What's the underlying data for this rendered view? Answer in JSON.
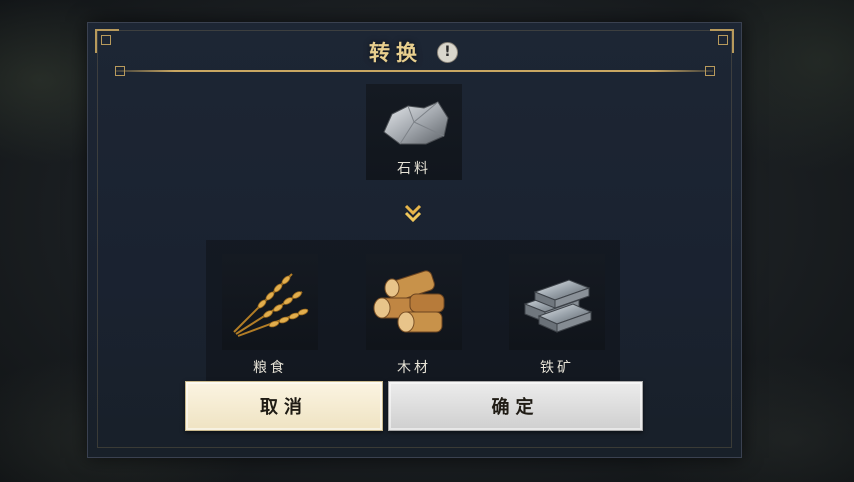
{
  "dialog": {
    "title": "转换",
    "info_icon": "exclamation-info-icon"
  },
  "source": {
    "label": "石料",
    "icon": "stone-icon"
  },
  "arrow": {
    "icon": "double-chevron-down-icon"
  },
  "targets": [
    {
      "label": "粮食",
      "icon": "wheat-icon"
    },
    {
      "label": "木材",
      "icon": "wood-logs-icon"
    },
    {
      "label": "铁矿",
      "icon": "iron-ingots-icon"
    }
  ],
  "buttons": {
    "cancel": "取消",
    "confirm": "确定"
  },
  "colors": {
    "title_gold": "#e8cf8e",
    "frame_gold": "#b89a5c",
    "panel_bg": "#1d2634"
  }
}
